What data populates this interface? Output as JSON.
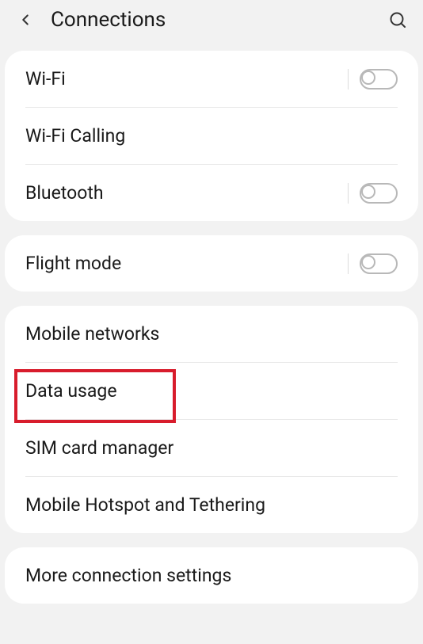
{
  "header": {
    "title": "Connections"
  },
  "groups": [
    {
      "items": [
        {
          "label": "Wi-Fi",
          "toggle": true,
          "on": false
        },
        {
          "label": "Wi-Fi Calling",
          "toggle": false
        },
        {
          "label": "Bluetooth",
          "toggle": true,
          "on": false
        }
      ]
    },
    {
      "items": [
        {
          "label": "Flight mode",
          "toggle": true,
          "on": false
        }
      ]
    },
    {
      "items": [
        {
          "label": "Mobile networks",
          "toggle": false
        },
        {
          "label": "Data usage",
          "toggle": false,
          "highlighted": true
        },
        {
          "label": "SIM card manager",
          "toggle": false
        },
        {
          "label": "Mobile Hotspot and Tethering",
          "toggle": false
        }
      ]
    },
    {
      "items": [
        {
          "label": "More connection settings",
          "toggle": false
        }
      ]
    }
  ]
}
